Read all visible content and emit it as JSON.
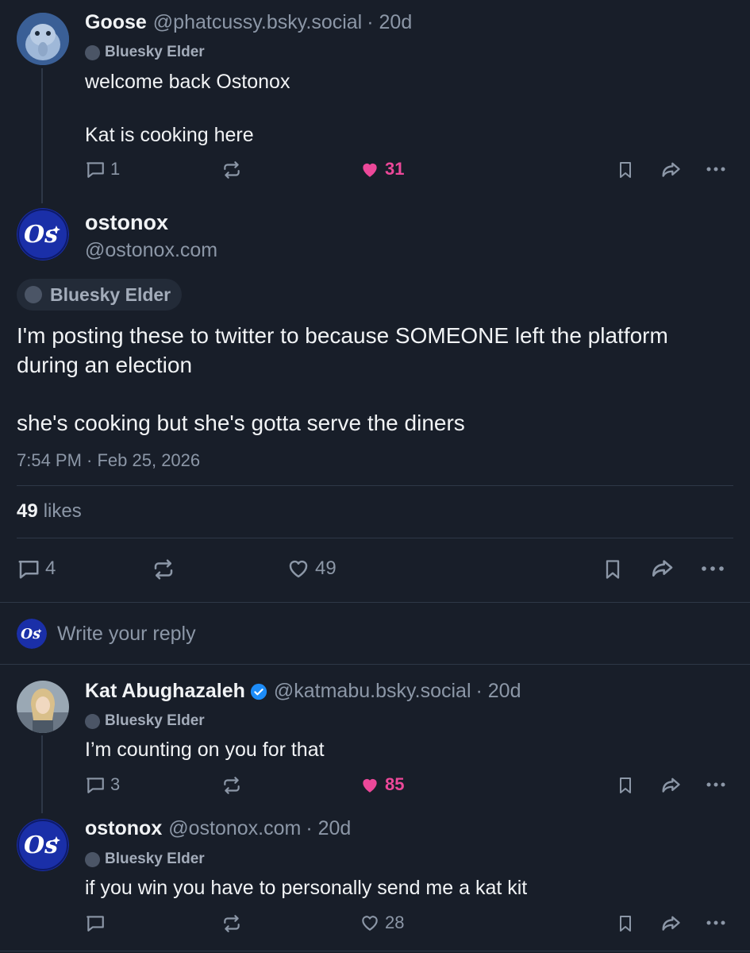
{
  "posts": [
    {
      "name": "Goose",
      "handle": "@phatcussy.bsky.social",
      "age": "· 20d",
      "badge": "Bluesky Elder",
      "text_line1": "welcome back Ostonox",
      "text_line2": "Kat is cooking here",
      "replies": "1",
      "likes": "31"
    },
    {
      "name": "Kat Abughazaleh",
      "handle": "@katmabu.bsky.social",
      "age": "· 20d",
      "badge": "Bluesky Elder",
      "text": "I’m counting on you for that",
      "replies": "3",
      "likes": "85"
    },
    {
      "name": "ostonox",
      "handle": "@ostonox.com",
      "age": "· 20d",
      "badge": "Bluesky Elder",
      "text": "if you win you have to personally send me a kat kit",
      "likes": "28"
    }
  ],
  "main_post": {
    "name": "ostonox",
    "handle": "@ostonox.com",
    "badge": "Bluesky Elder",
    "text_line1": "I'm posting these to twitter to because SOMEONE left the platform",
    "text_line2": "during an election",
    "text_line3": "she's cooking but she's gotta serve the diners",
    "timestamp": "7:54 PM · Feb 25, 2026",
    "likes_count": "49",
    "likes_label": "likes",
    "replies": "4",
    "likes": "49"
  },
  "reply_box": {
    "placeholder": "Write your reply"
  },
  "colors": {
    "background": "#181e29",
    "like_pink": "#ec4899",
    "muted": "#8c97a7",
    "avatar_blue": "#1a2fa8"
  },
  "icons": [
    "reply-icon",
    "repost-icon",
    "heart-icon",
    "bookmark-icon",
    "share-icon",
    "more-icon",
    "verified-icon"
  ]
}
